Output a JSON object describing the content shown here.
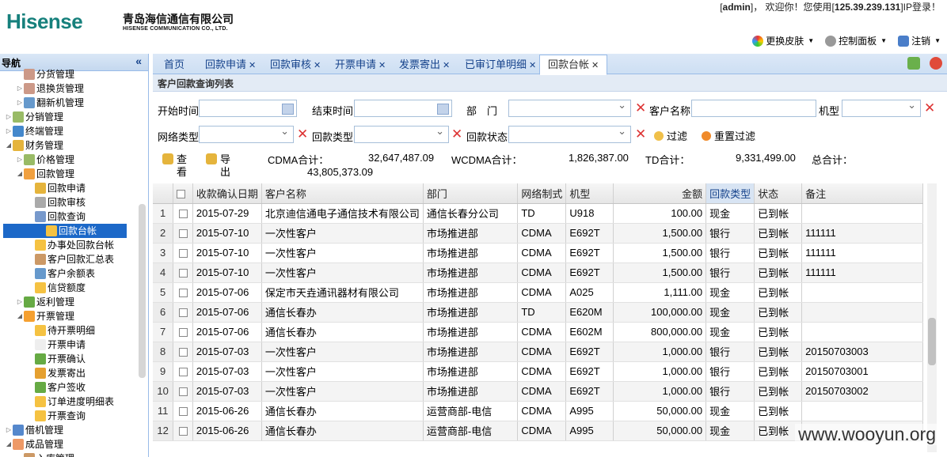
{
  "header": {
    "logo": "Hisense",
    "company_cn": "青岛海信通信有限公司",
    "company_en": "HISENSE COMMUNICATION CO., LTD.",
    "welcome_pre": "[",
    "user": "admin",
    "welcome_mid": "]， 欢迎你！您使用[",
    "ip": "125.39.239.131",
    "welcome_post": "]IP登录！",
    "skin": "更换皮肤",
    "control": "控制面板",
    "logout": "注销"
  },
  "nav": {
    "title": "导航",
    "items": [
      "分货管理",
      "退换货管理",
      "翻新机管理",
      "分销管理",
      "终端管理",
      "财务管理",
      "价格管理",
      "回款管理",
      "回款申请",
      "回款审核",
      "回款查询",
      "回款台帐",
      "办事处回款台帐",
      "客户回款汇总表",
      "客户余额表",
      "信贷额度",
      "返利管理",
      "开票管理",
      "待开票明细",
      "开票申请",
      "开票确认",
      "发票寄出",
      "客户签收",
      "订单进度明细表",
      "开票查询",
      "借机管理",
      "成品管理",
      "入库管理"
    ]
  },
  "tabs": [
    "首页",
    "回款申请",
    "回款审核",
    "开票申请",
    "发票寄出",
    "已审订单明细",
    "回款台帐"
  ],
  "panel_title": "客户回款查询列表",
  "filters": {
    "start": "开始时间",
    "end": "结束时间",
    "dept": "部　门",
    "customer": "客户名称",
    "model": "机型",
    "network": "网络类型",
    "pay_type": "回款类型",
    "status": "回款状态",
    "filter_btn": "过滤",
    "reset_btn": "重置过滤"
  },
  "toolbar": {
    "view": "查看",
    "export": "导出",
    "cdma_label": "CDMA合计：",
    "cdma": "32,647,487.09",
    "wcdma_label": "WCDMA合计：",
    "wcdma": "1,826,387.00",
    "td_label": "TD合计：",
    "td": "9,331,499.00",
    "total_label": "总合计：",
    "total": "43,805,373.09"
  },
  "columns": [
    "收款确认日期",
    "客户名称",
    "部门",
    "网络制式",
    "机型",
    "金额",
    "回款类型",
    "状态",
    "备注"
  ],
  "rows": [
    [
      "1",
      "2015-07-29",
      "北京迪信通电子通信技术有限公司",
      "通信长春分公司",
      "TD",
      "U918",
      "100.00",
      "现金",
      "已到帐",
      ""
    ],
    [
      "2",
      "2015-07-10",
      "一次性客户",
      "市场推进部",
      "CDMA",
      "E692T",
      "1,500.00",
      "银行",
      "已到帐",
      "111111"
    ],
    [
      "3",
      "2015-07-10",
      "一次性客户",
      "市场推进部",
      "CDMA",
      "E692T",
      "1,500.00",
      "银行",
      "已到帐",
      "111111"
    ],
    [
      "4",
      "2015-07-10",
      "一次性客户",
      "市场推进部",
      "CDMA",
      "E692T",
      "1,500.00",
      "银行",
      "已到帐",
      "111111"
    ],
    [
      "5",
      "2015-07-06",
      "保定市天垚通讯器材有限公司",
      "市场推进部",
      "CDMA",
      "A025",
      "1,111.00",
      "现金",
      "已到帐",
      ""
    ],
    [
      "6",
      "2015-07-06",
      "通信长春办",
      "市场推进部",
      "TD",
      "E620M",
      "100,000.00",
      "现金",
      "已到帐",
      ""
    ],
    [
      "7",
      "2015-07-06",
      "通信长春办",
      "市场推进部",
      "CDMA",
      "E602M",
      "800,000.00",
      "现金",
      "已到帐",
      ""
    ],
    [
      "8",
      "2015-07-03",
      "一次性客户",
      "市场推进部",
      "CDMA",
      "E692T",
      "1,000.00",
      "银行",
      "已到帐",
      "20150703003"
    ],
    [
      "9",
      "2015-07-03",
      "一次性客户",
      "市场推进部",
      "CDMA",
      "E692T",
      "1,000.00",
      "银行",
      "已到帐",
      "20150703001"
    ],
    [
      "10",
      "2015-07-03",
      "一次性客户",
      "市场推进部",
      "CDMA",
      "E692T",
      "1,000.00",
      "银行",
      "已到帐",
      "20150703002"
    ],
    [
      "11",
      "2015-06-26",
      "通信长春办",
      "运营商部-电信",
      "CDMA",
      "A995",
      "50,000.00",
      "现金",
      "已到帐",
      ""
    ],
    [
      "12",
      "2015-06-26",
      "通信长春办",
      "运营商部-电信",
      "CDMA",
      "A995",
      "50,000.00",
      "现金",
      "已到帐",
      ""
    ]
  ],
  "watermark": "www.wooyun.org"
}
